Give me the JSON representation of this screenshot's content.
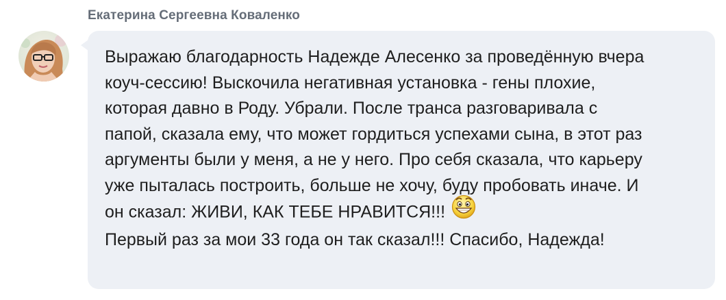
{
  "message": {
    "sender_name": "Екатерина Сергеевна Коваленко",
    "avatar_icon": "user-avatar-photo",
    "lines": [
      "Выражаю благодарность Надежде Алесенко за проведённую вчера",
      "коуч-сессию! Выскочила негативная установка - гены плохие,",
      "которая давно в Роду. Убрали. После транса разговаривала с",
      "папой, сказала ему, что может гордиться успехами сына, в этот раз",
      "аргументы были у меня, а не у него. Про себя сказала, что карьеру",
      "уже пыталась построить, больше не хочу, буду пробовать иначе. И",
      "он сказал: ЖИВИ, КАК ТЕБЕ НРАВИТСЯ!!!",
      "Первый раз за мои 33 года он так сказал!!! Спасибо, Надежда!"
    ],
    "emoji_icon": "grinning-face-emoji-icon"
  },
  "colors": {
    "bubble_background": "#edf0f5",
    "sender_name": "#656d78",
    "message_text": "#1e1e1e"
  }
}
